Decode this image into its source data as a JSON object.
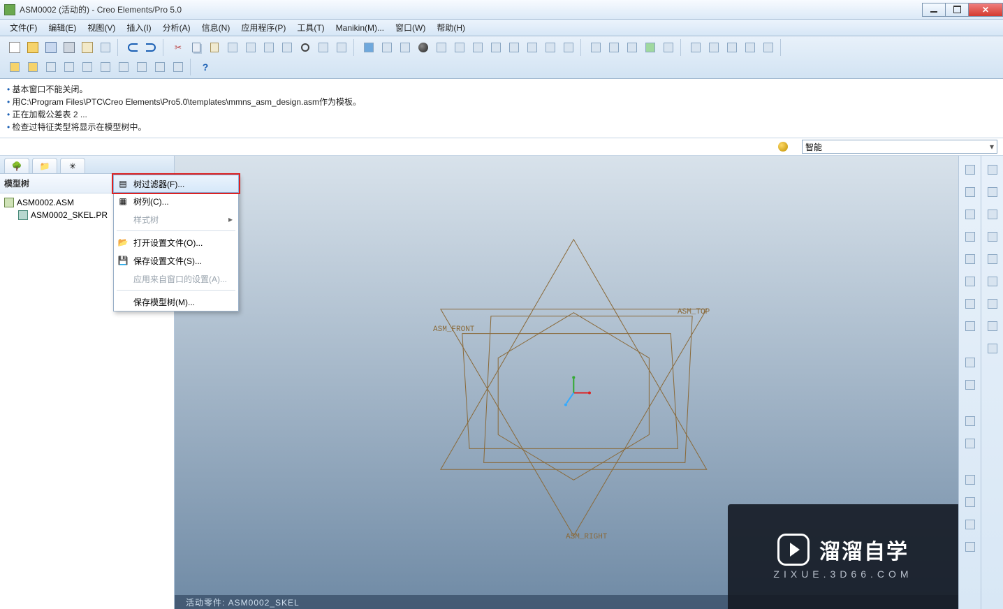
{
  "title": "ASM0002 (活动的) - Creo Elements/Pro 5.0",
  "menu": {
    "file": "文件(F)",
    "edit": "编辑(E)",
    "view": "视图(V)",
    "insert": "插入(I)",
    "analysis": "分析(A)",
    "info": "信息(N)",
    "application": "应用程序(P)",
    "tools": "工具(T)",
    "manikin": "Manikin(M)...",
    "window": "窗口(W)",
    "help": "帮助(H)"
  },
  "messages": {
    "m1": "基本窗口不能关闭。",
    "m2": "用C:\\Program Files\\PTC\\Creo Elements\\Pro5.0\\templates\\mmns_asm_design.asm作为模板。",
    "m3": "正在加载公差表 2 ...",
    "m4": "检查过特征类型将显示在模型树中。"
  },
  "filter": {
    "label": "智能"
  },
  "left_panel": {
    "tree_label": "模型树",
    "root": "ASM0002.ASM",
    "child1": "ASM0002_SKEL.PR"
  },
  "context_menu": {
    "tree_filter": "树过滤器(F)...",
    "tree_column": "树列(C)...",
    "style_tree": "样式树",
    "open_settings": "打开设置文件(O)...",
    "save_settings": "保存设置文件(S)...",
    "apply_window_settings": "应用来自窗口的设置(A)...",
    "save_model_tree": "保存模型树(M)..."
  },
  "viewport": {
    "label_front": "ASM_FRONT",
    "label_top": "ASM_TOP",
    "label_right": "ASM_RIGHT",
    "status_text": "活动零件: ASM0002_SKEL"
  },
  "watermark": {
    "main": "溜溜自学",
    "sub": "ZIXUE.3D66.COM"
  }
}
